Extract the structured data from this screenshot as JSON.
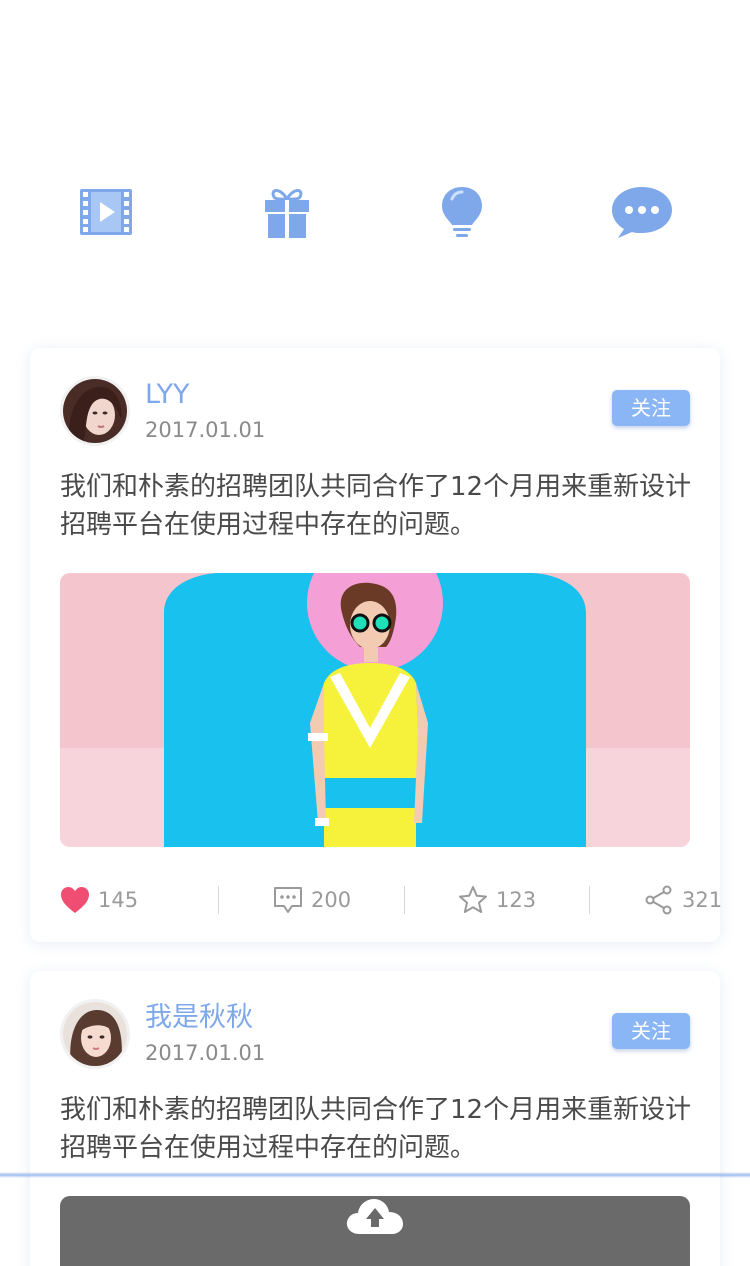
{
  "toolbar": {
    "icons": [
      {
        "name": "video-icon",
        "color": "#7fa8ea"
      },
      {
        "name": "gift-icon",
        "color": "#7fa8ea"
      },
      {
        "name": "lightbulb-icon",
        "color": "#7fa8ea"
      },
      {
        "name": "chat-bubble-icon",
        "color": "#7fa8ea"
      }
    ]
  },
  "colors": {
    "accent": "#7fa8ea",
    "follow_button": "#8bb6f6",
    "like_heart": "#ef4e72"
  },
  "posts": [
    {
      "username": "LYY",
      "date": "2017.01.01",
      "follow_label": "关注",
      "content": "我们和朴素的招聘团队共同合作了12个月用来重新设计招聘平台在使用过程中存在的问题。",
      "likes": "145",
      "comments": "200",
      "favorites": "123",
      "shares": "321"
    },
    {
      "username": "我是秋秋",
      "date": "2017.01.01",
      "follow_label": "关注",
      "content": "我们和朴素的招聘团队共同合作了12个月用来重新设计招聘平台在使用过程中存在的问题。"
    }
  ]
}
